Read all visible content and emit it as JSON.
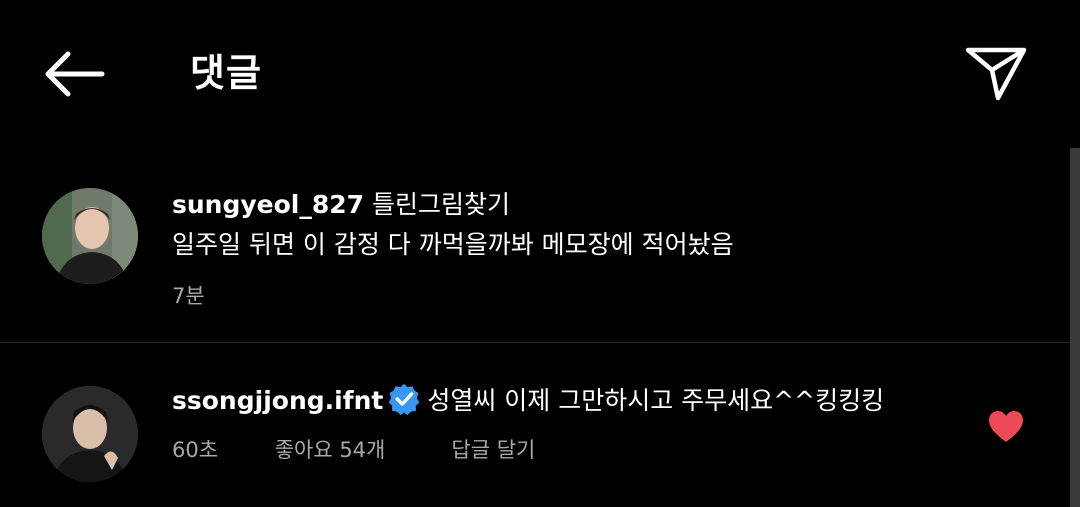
{
  "header": {
    "title": "댓글",
    "back_icon": "arrow-left-icon",
    "send_icon": "paper-plane-icon"
  },
  "comments": [
    {
      "username": "sungyeol_827",
      "text_line1": "틀린그림찾기",
      "text_line2": "일주일 뒤면 이 감정 다 까먹을까봐 메모장에 적어놨음",
      "time": "7분"
    },
    {
      "username": "ssongjjong.ifnt",
      "verified": true,
      "text": "성열씨 이제 그만하시고 주무세요^^킹킹킹",
      "time": "60초",
      "likes": "좋아요 54개",
      "reply_label": "답글 달기",
      "liked": true,
      "heart_color": "#ed4956"
    }
  ],
  "colors": {
    "background": "#000000",
    "text": "#ffffff",
    "meta": "#a8a8a8",
    "verified": "#3897f0"
  }
}
